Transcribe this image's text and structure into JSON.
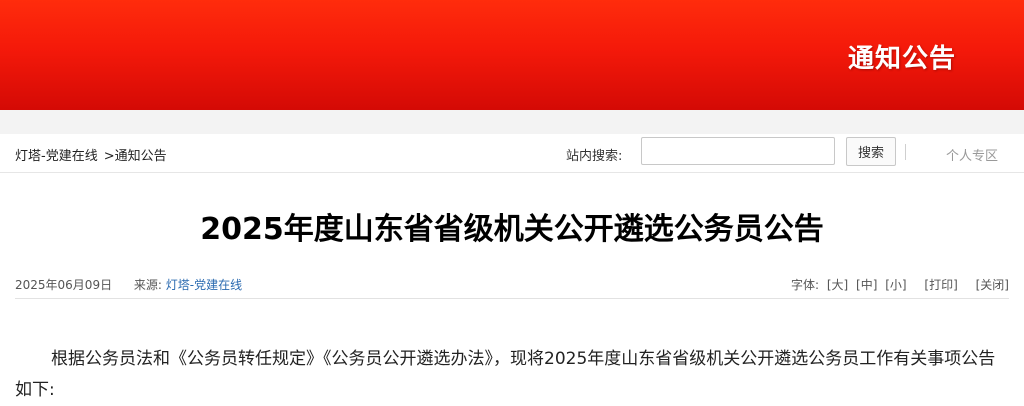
{
  "header": {
    "banner_title": "通知公告"
  },
  "nav": {
    "breadcrumb_home": "灯塔-党建在线",
    "breadcrumb_current": ">通知公告",
    "search_label": "站内搜索:",
    "search_value": "",
    "search_placeholder": "",
    "search_button": "搜索",
    "personal_area": "个人专区"
  },
  "article": {
    "title": "2025年度山东省省级机关公开遴选公务员公告",
    "date": "2025年06月09日",
    "source_label": "来源:",
    "source_value": "灯塔-党建在线",
    "font_label": "字体:",
    "font_large": "[大]",
    "font_medium": "[中]",
    "font_small": "[小]",
    "print": "[打印]",
    "close": "[关闭]",
    "paragraph_1": "根据公务员法和《公务员转任规定》《公务员公开遴选办法》，现将2025年度山东省省级机关公开遴选公务员工作有关事项公告如下:"
  },
  "colors": {
    "banner_red": "#f4190a",
    "link_blue": "#2a6ab0"
  }
}
